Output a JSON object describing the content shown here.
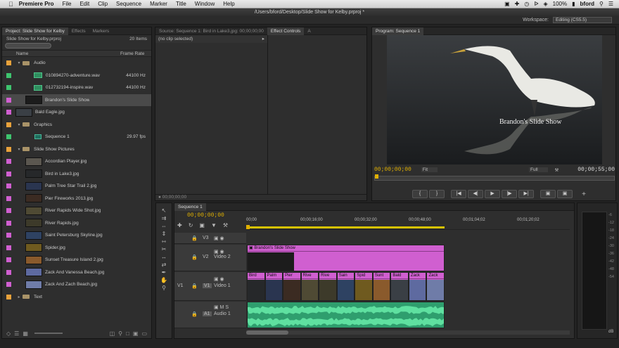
{
  "menubar": {
    "app": "Premiere Pro",
    "items": [
      "File",
      "Edit",
      "Clip",
      "Sequence",
      "Marker",
      "Title",
      "Window",
      "Help"
    ],
    "battery": "100%",
    "user": "bford"
  },
  "titlebar": {
    "path": "/Users/bford/Desktop/Slide Show for Kelby.prproj *"
  },
  "workspace": {
    "label": "Workspace:",
    "value": "Editing (CS5.5)"
  },
  "project": {
    "tabs": [
      "Project: Slide Show for Kelby",
      "Effects",
      "Markers"
    ],
    "file": "Slide Show for Kelby.prproj",
    "count": "20 Items",
    "col_name": "Name",
    "col_rate": "Frame Rate",
    "rows": [
      {
        "name": "Audio",
        "kind": "folder",
        "color": "#e9a23b",
        "indent": 0,
        "open": true
      },
      {
        "name": "010894270-adventure.wav",
        "kind": "audio",
        "color": "#3ec46e",
        "indent": 1,
        "rate": "44100 Hz"
      },
      {
        "name": "012732194-inspire.wav",
        "kind": "audio",
        "color": "#3ec46e",
        "indent": 1,
        "rate": "44100 Hz"
      },
      {
        "name": "Brandon's Slide Show",
        "kind": "thumb",
        "color": "#d05fd0",
        "indent": 1,
        "sel": true,
        "thumb": "#1c1c1c"
      },
      {
        "name": "Bald Eagle.jpg",
        "kind": "thumb",
        "color": "#d05fd0",
        "indent": 0,
        "thumb": "#3a3f45"
      },
      {
        "name": "Graphics",
        "kind": "folder",
        "color": "#e9a23b",
        "indent": 0,
        "open": true
      },
      {
        "name": "Sequence 1",
        "kind": "seq",
        "color": "#3ec46e",
        "indent": 1,
        "rate": "29.97 fps"
      },
      {
        "name": "Slide Show Pictures",
        "kind": "folder",
        "color": "#e9a23b",
        "indent": 0,
        "open": true
      },
      {
        "name": "Accordian Player.jpg",
        "kind": "thumb",
        "color": "#d05fd0",
        "indent": 1,
        "thumb": "#5b5750"
      },
      {
        "name": "Bird in Lake3.jpg",
        "kind": "thumb",
        "color": "#d05fd0",
        "indent": 1,
        "thumb": "#26282a"
      },
      {
        "name": "Palm Tree Star Trail 2.jpg",
        "kind": "thumb",
        "color": "#d05fd0",
        "indent": 1,
        "thumb": "#2a3550"
      },
      {
        "name": "Pier Fireworks 2013.jpg",
        "kind": "thumb",
        "color": "#d05fd0",
        "indent": 1,
        "thumb": "#3b2b22"
      },
      {
        "name": "River Rapids Wide Shot.jpg",
        "kind": "thumb",
        "color": "#d05fd0",
        "indent": 1,
        "thumb": "#4f4a34"
      },
      {
        "name": "River Rapids.jpg",
        "kind": "thumb",
        "color": "#d05fd0",
        "indent": 1,
        "thumb": "#3d3a2a"
      },
      {
        "name": "Saint Petersburg Skyline.jpg",
        "kind": "thumb",
        "color": "#d05fd0",
        "indent": 1,
        "thumb": "#2e4262"
      },
      {
        "name": "Spider.jpg",
        "kind": "thumb",
        "color": "#d05fd0",
        "indent": 1,
        "thumb": "#6f5a1f"
      },
      {
        "name": "Sunset Treasure Island 2.jpg",
        "kind": "thumb",
        "color": "#d05fd0",
        "indent": 1,
        "thumb": "#8a5a2c"
      },
      {
        "name": "Zack And Vanessa Beach.jpg",
        "kind": "thumb",
        "color": "#d05fd0",
        "indent": 1,
        "thumb": "#5e6aa0"
      },
      {
        "name": "Zack And Zach Beach.jpg",
        "kind": "thumb",
        "color": "#d05fd0",
        "indent": 1,
        "thumb": "#6f7ca8"
      },
      {
        "name": "Text",
        "kind": "folder",
        "color": "#e9a23b",
        "indent": 0,
        "open": false
      }
    ]
  },
  "source": {
    "tabs": [
      "Source: Sequence 1: Bird in Lake3.jpg: 00;00;00;00",
      "Effect Controls",
      "A"
    ],
    "no_clip": "(no clip selected)",
    "timecode": "00;00;00;00"
  },
  "program": {
    "tab": "Program: Sequence 1",
    "overlay": "Brandon's Slide Show",
    "tc_in": "00;00;00;00",
    "tc_out": "00;00;55;00",
    "fit": "Fit",
    "quality": "Full"
  },
  "timeline": {
    "tab": "Sequence 1",
    "timecode": "00;00;00;00",
    "ruler": [
      "00;00",
      "00;00;16;00",
      "00;00;32;00",
      "00;00;48;00",
      "00;01;04;02",
      "00;01;20;02"
    ],
    "tracks": {
      "v3": "V3",
      "v2": "V2",
      "v1": "V1",
      "a1": "A1",
      "video2": "Video 2",
      "video1": "Video 1",
      "audio1": "Audio 1",
      "src_v1": "V1",
      "src_a1": "A1"
    },
    "nested_clip": "Brandon's Slide Show",
    "v1_clips": [
      "Bird",
      "Palm",
      "Pier",
      "Rive",
      "Rive",
      "Sain",
      "Spid",
      "Sunt",
      "Bald",
      "Zack",
      "Zack"
    ]
  },
  "meter": {
    "db": "dB"
  },
  "colors": {
    "accent": "#e0b000",
    "video_clip": "#d05fd0",
    "audio_clip": "#3ec46e"
  }
}
